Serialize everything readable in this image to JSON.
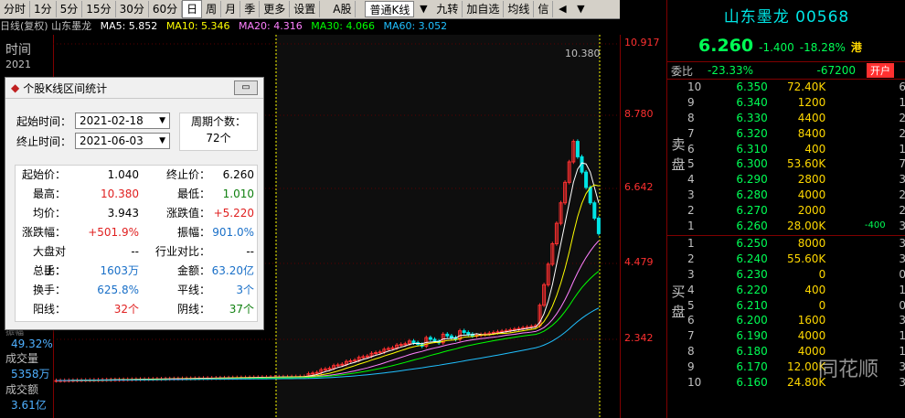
{
  "toolbar": {
    "period_buttons": [
      "分时",
      "1分",
      "5分",
      "15分",
      "30分",
      "60分",
      "日",
      "周",
      "月",
      "季",
      "更多",
      "设置"
    ],
    "active_period": "日",
    "a_shares": "A股",
    "kline_type": "普通K线",
    "jiu_zhuan": "九转",
    "add_self": "加自选",
    "moving_avg": "均线",
    "stock_info": "信"
  },
  "ma_line": {
    "title": "日线(复权) 山东墨龙",
    "ma5": "MA5: 5.852",
    "ma10": "MA10: 5.346",
    "ma20": "MA20: 4.316",
    "ma30": "MA30: 4.066",
    "ma60": "MA60: 3.052",
    "colors": {
      "ma5": "#ffffff",
      "ma10": "#ffff00",
      "ma20": "#ff80ff",
      "ma30": "#00ff00",
      "ma60": "#20c0ff"
    }
  },
  "left_panel": {
    "time_label": "时间",
    "year": "2021",
    "price_partial": "振幅",
    "pct": "49.32%",
    "vol_label": "成交量",
    "vol_val": "5358万",
    "amt_label": "成交额",
    "amt_val": "3.61亿"
  },
  "axis": {
    "ticks": [
      "10.917",
      "8.780",
      "6.642",
      "4.479",
      "2.342"
    ],
    "peak_label": "10.380"
  },
  "dialog": {
    "title": "个股K线区间统计",
    "start_label": "起始时间：",
    "start_value": "2021-02-18",
    "end_label": "终止时间：",
    "end_value": "2021-06-03",
    "period_label": "周期个数：",
    "period_value": "72个",
    "stats": [
      {
        "k1": "起始价：",
        "v1": "1.040",
        "c1": "",
        "k2": "终止价：",
        "v2": "6.260",
        "c2": ""
      },
      {
        "k1": "最高：",
        "v1": "10.380",
        "c1": "red",
        "k2": "最低：",
        "v2": "1.010",
        "c2": "green"
      },
      {
        "k1": "均价：",
        "v1": "3.943",
        "c1": "",
        "k2": "涨跌值：",
        "v2": "+5.220",
        "c2": "red"
      },
      {
        "k1": "涨跌幅：",
        "v1": "+501.9%",
        "c1": "red",
        "k2": "振幅：",
        "v2": "901.0%",
        "c2": "blue"
      },
      {
        "k1": "大盘对比：",
        "v1": "--",
        "c1": "",
        "k2": "行业对比：",
        "v2": "--",
        "c2": ""
      },
      {
        "k1": "总手：",
        "v1": "1603万",
        "c1": "blue",
        "k2": "金额：",
        "v2": "63.20亿",
        "c2": "blue"
      },
      {
        "k1": "换手：",
        "v1": "625.8%",
        "c1": "blue",
        "k2": "平线：",
        "v2": "3个",
        "c2": "blue"
      },
      {
        "k1": "阳线：",
        "v1": "32个",
        "c1": "red",
        "k2": "阴线：",
        "v2": "37个",
        "c2": "green"
      }
    ]
  },
  "quote": {
    "title": "山东墨龙 00568",
    "price": "6.260",
    "change": "-1.400",
    "change_pct": "-18.28%",
    "flag": "港",
    "wei_label": "委比",
    "wei_pct": "-23.33%",
    "wei_diff": "-67200",
    "open_btn": "开户",
    "sell_label": "卖盘",
    "buy_label": "买盘",
    "asks": [
      {
        "n": "10",
        "p": "6.350",
        "v": "72.40K",
        "c": "",
        "t": "6"
      },
      {
        "n": "9",
        "p": "6.340",
        "v": "1200",
        "c": "",
        "t": "1"
      },
      {
        "n": "8",
        "p": "6.330",
        "v": "4400",
        "c": "",
        "t": "2"
      },
      {
        "n": "7",
        "p": "6.320",
        "v": "8400",
        "c": "",
        "t": "2"
      },
      {
        "n": "6",
        "p": "6.310",
        "v": "400",
        "c": "",
        "t": "1"
      },
      {
        "n": "5",
        "p": "6.300",
        "v": "53.60K",
        "c": "",
        "t": "7"
      },
      {
        "n": "4",
        "p": "6.290",
        "v": "2800",
        "c": "",
        "t": "3"
      },
      {
        "n": "3",
        "p": "6.280",
        "v": "4000",
        "c": "",
        "t": "2"
      },
      {
        "n": "2",
        "p": "6.270",
        "v": "2000",
        "c": "",
        "t": "2"
      },
      {
        "n": "1",
        "p": "6.260",
        "v": "28.00K",
        "c": "-400",
        "t": "3"
      }
    ],
    "bids": [
      {
        "n": "1",
        "p": "6.250",
        "v": "8000",
        "c": "",
        "t": "3"
      },
      {
        "n": "2",
        "p": "6.240",
        "v": "55.60K",
        "c": "",
        "t": "3"
      },
      {
        "n": "3",
        "p": "6.230",
        "v": "0",
        "c": "",
        "t": "0"
      },
      {
        "n": "4",
        "p": "6.220",
        "v": "400",
        "c": "",
        "t": "1"
      },
      {
        "n": "5",
        "p": "6.210",
        "v": "0",
        "c": "",
        "t": "0"
      },
      {
        "n": "6",
        "p": "6.200",
        "v": "1600",
        "c": "",
        "t": "3"
      },
      {
        "n": "7",
        "p": "6.190",
        "v": "4000",
        "c": "",
        "t": "1"
      },
      {
        "n": "8",
        "p": "6.180",
        "v": "4000",
        "c": "",
        "t": "1"
      },
      {
        "n": "9",
        "p": "6.170",
        "v": "12.00K",
        "c": "",
        "t": "3"
      },
      {
        "n": "10",
        "p": "6.160",
        "v": "24.80K",
        "c": "",
        "t": "3"
      }
    ]
  },
  "watermark": "同花顺"
}
